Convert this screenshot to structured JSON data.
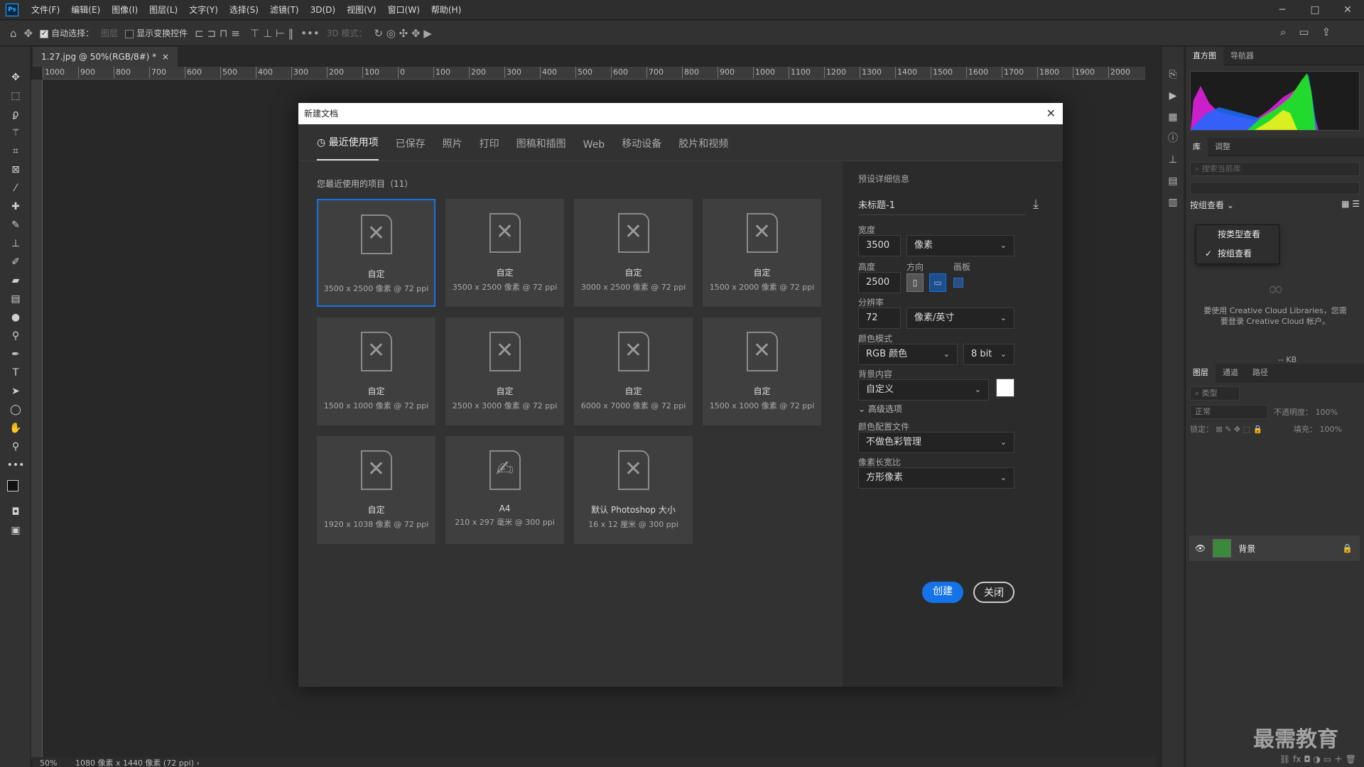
{
  "app": {
    "logo": "Ps"
  },
  "menu": [
    "文件(F)",
    "编辑(E)",
    "图像(I)",
    "图层(L)",
    "文字(Y)",
    "选择(S)",
    "滤镜(T)",
    "3D(D)",
    "视图(V)",
    "窗口(W)",
    "帮助(H)"
  ],
  "window_buttons": [
    "─",
    "□",
    "✕"
  ],
  "options": {
    "auto_select": "自动选择：",
    "layer_select": "图层",
    "show_transform": "显示变换控件",
    "mode_3d": "3D 模式："
  },
  "doc_tab": {
    "title": "1.27.jpg @ 50%(RGB/8#) *"
  },
  "ruler_ticks": [
    "1000",
    "900",
    "800",
    "700",
    "600",
    "500",
    "400",
    "300",
    "200",
    "100",
    "0",
    "100",
    "200",
    "300",
    "400",
    "500",
    "600",
    "700",
    "800",
    "900",
    "1000",
    "1100",
    "1200",
    "1300",
    "1400",
    "1500",
    "1600",
    "1700",
    "1800",
    "1900",
    "2000"
  ],
  "status": {
    "zoom": "50%",
    "info": "1080 像素 x 1440 像素 (72 ppi)"
  },
  "panels": {
    "top_tabs": [
      "直方图",
      "导航器"
    ],
    "lib_tabs": [
      "库",
      "调整"
    ],
    "lib_search_placeholder": "搜索当前库",
    "view_by": "按组查看",
    "popup": [
      {
        "label": "按类型查看",
        "checked": false
      },
      {
        "label": "按组查看",
        "checked": true
      }
    ],
    "cc_message": "要使用 Creative Cloud Libraries，您需要登录 Creative Cloud 帐户。",
    "kb": "-- KB",
    "layer_tabs": [
      "图层",
      "通道",
      "路径"
    ],
    "kind_search": "类型",
    "blend_mode": "正常",
    "opacity_label": "不透明度：",
    "opacity_value": "100%",
    "lock_label": "锁定：",
    "fill_label": "填充：",
    "fill_value": "100%",
    "layer_name": "背景"
  },
  "watermark": "最需教育",
  "dialog": {
    "title": "新建文档",
    "tabs": [
      "最近使用项",
      "已保存",
      "照片",
      "打印",
      "图稿和插图",
      "Web",
      "移动设备",
      "胶片和视频"
    ],
    "recent_label": "您最近使用的项目（11）",
    "presets": [
      {
        "name": "自定",
        "dims": "3500 x 2500 像素 @ 72 ppi",
        "selected": true
      },
      {
        "name": "自定",
        "dims": "3500 x 2500 像素 @ 72 ppi"
      },
      {
        "name": "自定",
        "dims": "3000 x 2500 像素 @ 72 ppi"
      },
      {
        "name": "自定",
        "dims": "1500 x 2000 像素 @ 72 ppi"
      },
      {
        "name": "自定",
        "dims": "1500 x 1000 像素 @ 72 ppi"
      },
      {
        "name": "自定",
        "dims": "2500 x 3000 像素 @ 72 ppi"
      },
      {
        "name": "自定",
        "dims": "6000 x 7000 像素 @ 72 ppi"
      },
      {
        "name": "自定",
        "dims": "1500 x 1000 像素 @ 72 ppi"
      },
      {
        "name": "自定",
        "dims": "1920 x 1038 像素 @ 72 ppi"
      },
      {
        "name": "A4",
        "dims": "210 x 297 毫米 @ 300 ppi"
      },
      {
        "name": "默认 Photoshop 大小",
        "dims": "16 x 12 厘米 @ 300 ppi"
      }
    ],
    "details": {
      "heading": "预设详细信息",
      "name": "未标题-1",
      "width_label": "宽度",
      "width": "3500",
      "width_unit": "像素",
      "height_label": "高度",
      "height": "2500",
      "orientation_label": "方向",
      "artboard_label": "画板",
      "resolution_label": "分辨率",
      "resolution": "72",
      "resolution_unit": "像素/英寸",
      "color_mode_label": "颜色模式",
      "color_mode": "RGB 颜色",
      "bit_depth": "8 bit",
      "bg_label": "背景内容",
      "bg": "自定义",
      "bg_color": "#ffffff",
      "advanced": "高级选项",
      "profile_label": "颜色配置文件",
      "profile": "不做色彩管理",
      "pixel_aspect_label": "像素长宽比",
      "pixel_aspect": "方形像素"
    },
    "create": "创建",
    "close": "关闭"
  }
}
